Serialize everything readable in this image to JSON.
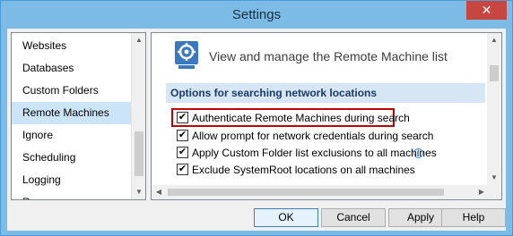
{
  "window": {
    "title": "Settings",
    "close_glyph": "✕"
  },
  "nav": {
    "items": [
      {
        "label": "Websites",
        "selected": false
      },
      {
        "label": "Databases",
        "selected": false
      },
      {
        "label": "Custom Folders",
        "selected": false
      },
      {
        "label": "Remote Machines",
        "selected": true
      },
      {
        "label": "Ignore",
        "selected": false
      },
      {
        "label": "Scheduling",
        "selected": false
      },
      {
        "label": "Logging",
        "selected": false
      },
      {
        "label": "Resources",
        "selected": false
      }
    ]
  },
  "content": {
    "header_icon": "remote-machine-gear-icon",
    "header_text": "View and manage the Remote Machine list",
    "section_title": "Options for searching network locations",
    "options": [
      {
        "label": "Authenticate Remote Machines during search",
        "checked": true
      },
      {
        "label": "Allow prompt for network credentials during search",
        "checked": true
      },
      {
        "label": "Apply Custom Folder list exclusions to all machines",
        "checked": true
      },
      {
        "label": "Exclude SystemRoot locations on all machines",
        "checked": true
      }
    ],
    "info_glyph": "i"
  },
  "buttons": {
    "ok": "OK",
    "cancel": "Cancel",
    "apply": "Apply",
    "help": "Help"
  },
  "colors": {
    "title_bar": "#7bbbe6",
    "close_button": "#c7463f",
    "selected_item": "#cce4f7",
    "section_header": "#d7e6f5",
    "highlight_border": "#c00000"
  }
}
